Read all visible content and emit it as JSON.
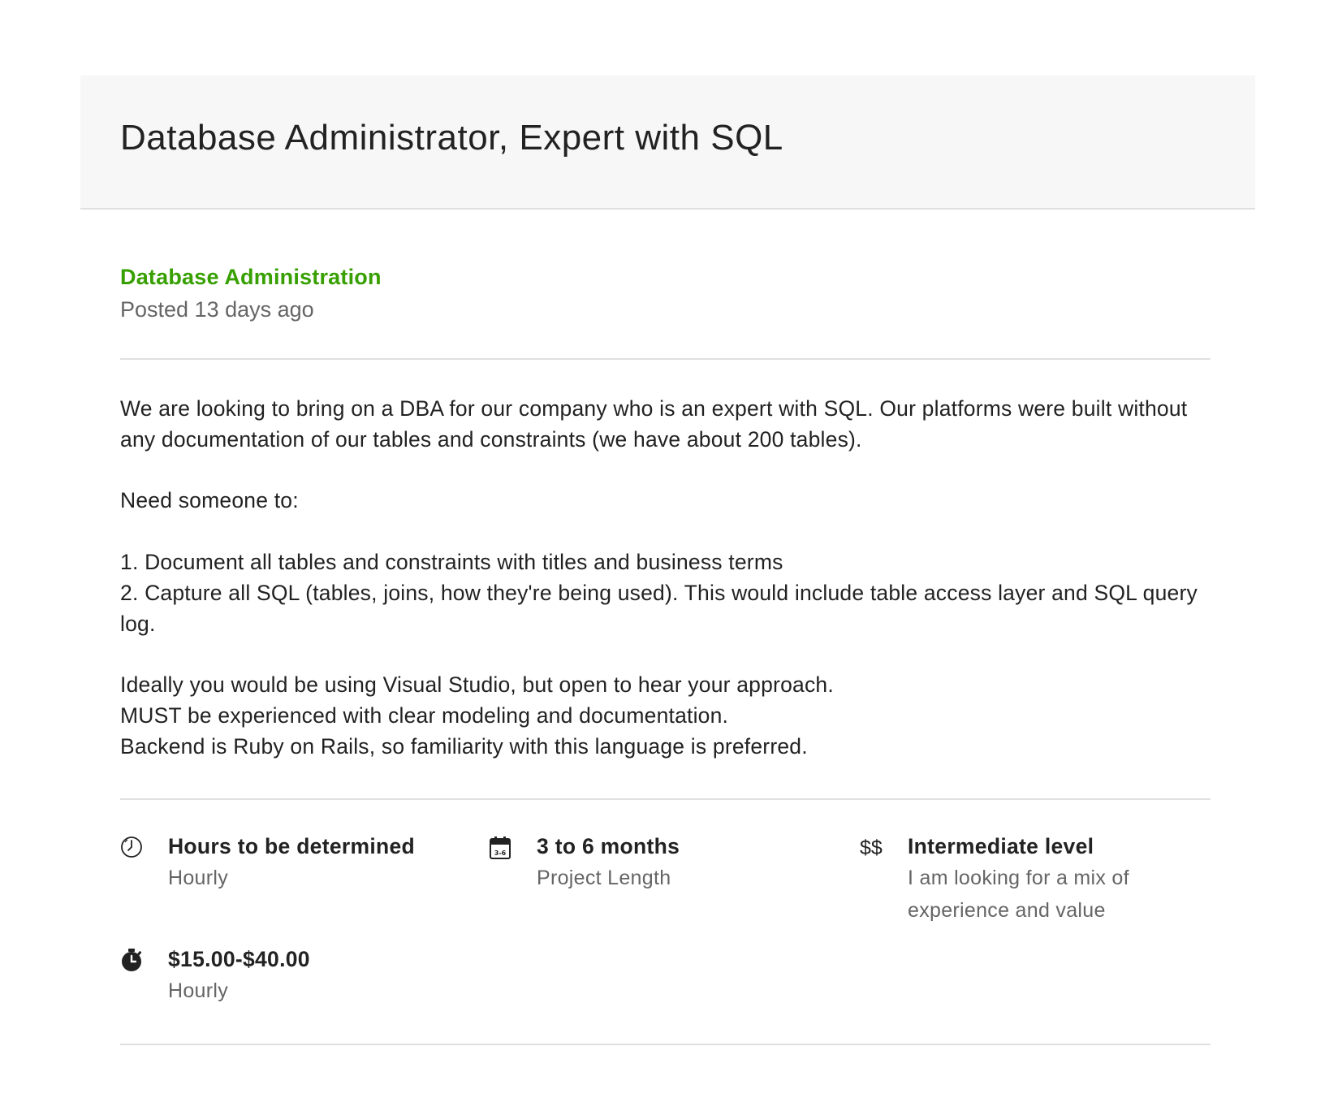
{
  "job": {
    "title": "Database Administrator, Expert with SQL",
    "category": "Database Administration",
    "posted": "Posted 13 days ago",
    "description": "We are looking to bring on a DBA for our company who is an expert with SQL. Our platforms were built without any documentation of our tables and constraints (we have about 200 tables).\n\nNeed someone to:\n\n1. Document all tables and constraints with titles and business terms\n2. Capture all SQL (tables, joins, how they're being used). This would include table access layer and SQL query log.\n\nIdeally you would be using Visual Studio, but open to hear your approach.\nMUST be experienced with clear modeling and documentation.\nBackend is Ruby on Rails, so familiarity with this language is preferred."
  },
  "features": {
    "hours": {
      "icon": "clock-icon",
      "title": "Hours to be determined",
      "sub": "Hourly"
    },
    "length": {
      "icon": "calendar-icon",
      "title": "3 to 6 months",
      "sub": "Project Length",
      "icon_text": "3-6"
    },
    "level": {
      "icon": "dollar-icon",
      "icon_text": "$$",
      "title": "Intermediate level",
      "sub": "I am looking for a mix of experience and value"
    },
    "rate": {
      "icon": "stopwatch-icon",
      "title": "$15.00-$40.00",
      "sub": "Hourly"
    }
  },
  "colors": {
    "category": "#37a000",
    "muted": "#656565",
    "header_bg": "#f7f7f7"
  }
}
